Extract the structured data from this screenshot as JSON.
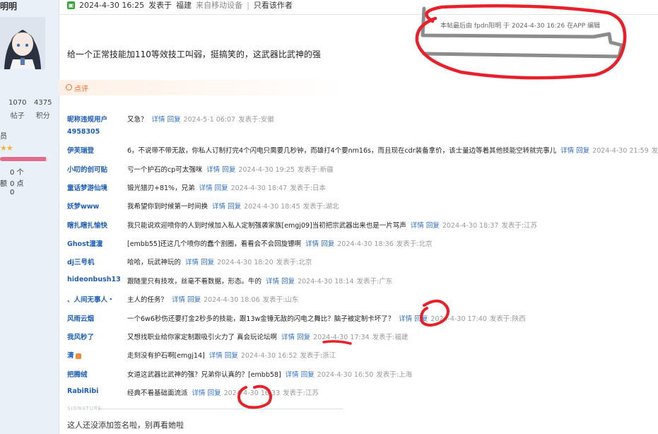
{
  "sidebar": {
    "name": "明明",
    "stats": [
      {
        "num": "",
        "label": ""
      },
      {
        "num": "1070",
        "label": "帖子"
      },
      {
        "num": "4375",
        "label": "积分"
      }
    ],
    "member": "员",
    "lines": [
      "0 个",
      "0 点",
      "0"
    ],
    "lines_prefix": [
      "",
      "额",
      ""
    ],
    "level_fraction": 0.95
  },
  "topbar": {
    "date": "2024-4-30 16:25",
    "posted_in": "发表于",
    "location": "福建",
    "device": "来自移动设备",
    "only_author": "只看该作者"
  },
  "edit_note": "本帖最后由 fpdn阳明 于 2024-4-30 16:26 在APP 编辑",
  "post_text": "给一个正常技能加110等效技工叫弱，挺搞笑的，这武器比武神的强",
  "comment_label": "点评",
  "comments": [
    {
      "user": "昵称违规用户4958305",
      "body": "又急？",
      "time": "2024-5-1 06:07",
      "loc": "发表于:安徽"
    },
    {
      "user": "伊芙瑞登",
      "body": "6，不说带不带无敌，你私人订制打完4个闪电只需要几秒钟，而雄打4个要nm16s，而且现在cdr装备拿价，该士量边等着其他技能空转就完事儿",
      "time": "2024-4-30 21:59",
      "loc": "发表于:四川"
    },
    {
      "user": "小叨的创可贴",
      "body": "亏一个护石的cp可太强咪",
      "time": "2024-4-30 19:25",
      "loc": "发表于:新疆"
    },
    {
      "user": "童话梦游仙境",
      "body": "锻光猎刃+81%，兄弟",
      "time": "2024-4-30 18:47",
      "loc": "发表于:日本"
    },
    {
      "user": "妖梦www",
      "body": "我希望你到时候第一时间换",
      "time": "2024-4-30 18:45",
      "loc": "发表于:湖北"
    },
    {
      "user": "瞎扎瞎扎愉快",
      "body": "我只能说欢迎喷你的人到时候加入私人定制强袭家族[emgj09]当初把宗武器出来也是一片骂声",
      "time": "2024-4-30 18:37",
      "loc": "发表于:江苏"
    },
    {
      "user": "Ghost潼潼",
      "body": "[embb55]还这几个喷你的蠢个割圈，看看会不会回旋镖啊",
      "time": "2024-4-30 18:36",
      "loc": "发表于:北京"
    },
    {
      "user": "dj三号机",
      "body": "哈哈，玩武神玩的",
      "time": "2024-4-30 18:20",
      "loc": "发表于:北京"
    },
    {
      "user": "hideonbush13",
      "body": "跟随里只有技攻，丝毫不看数据，形态。牛的",
      "time": "2024-4-30 18:14",
      "loc": "发表于:广东"
    },
    {
      "user": "、人间无事人・",
      "body": "主人的任务？",
      "time": "2024-4-30 18:06",
      "loc": "发表于:山东"
    },
    {
      "user": "风雨云烟",
      "body": "一个6w6秒伤还要打金2秒多的技能，跟13w金锤无敌的闪电之舞比？脑子被定制卡坏了？",
      "time": "2024-4-30 17:40",
      "loc": "发表于:陕西"
    },
    {
      "user": "我风秒了",
      "body": "又想找职业给你家定制跟吸引火力了 真会玩论坛啊",
      "time": "2024-4-30 17:34",
      "loc": "发表于:福建"
    },
    {
      "user": "清",
      "body": "走刻没有护石啊[emgj14]",
      "time": "2024-4-30 16:52",
      "loc": "发表于:浙江"
    },
    {
      "user": "把腾绒",
      "body": "女道这武器比武神的强？兄弟你认真的？[embb58]",
      "time": "2024-4-30 16:50",
      "loc": "发表于:上海"
    },
    {
      "user": "RabiRibi",
      "body": "经典不看基础面流派",
      "time": "2024-4-30 16:33",
      "loc": "发表于:江苏"
    }
  ],
  "action_detail": "详情",
  "action_reply": "回复",
  "signature_label": "SIGNATURE",
  "signature_text": "这人还没添加签名啦，别再看她啦",
  "colors": {
    "link": "#1f5fb6",
    "accent": "#ff6b25",
    "annotation": "#e8202a"
  }
}
